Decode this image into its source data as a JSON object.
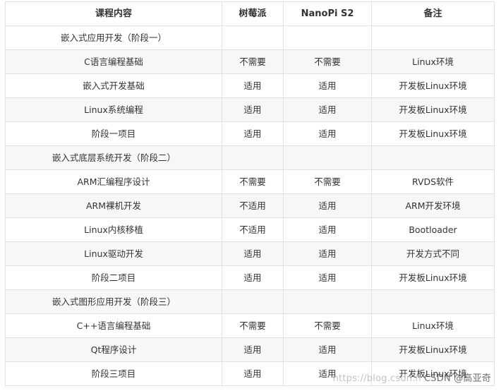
{
  "table": {
    "headers": [
      "课程内容",
      "树莓派",
      "NanoPi S2",
      "备注"
    ],
    "rows": [
      {
        "type": "section",
        "label": "嵌入式应用开发（阶段一）",
        "indent": 78
      },
      {
        "type": "data",
        "cells": [
          "C语言编程基础",
          "不需要",
          "不需要",
          "Linux环境"
        ]
      },
      {
        "type": "data",
        "cells": [
          "嵌入式开发基础",
          "适用",
          "适用",
          "开发板Linux环境"
        ]
      },
      {
        "type": "data",
        "cells": [
          "Linux系统编程",
          "适用",
          "适用",
          "开发板Linux环境"
        ]
      },
      {
        "type": "data",
        "cells": [
          "阶段一项目",
          "适用",
          "适用",
          "开发板Linux环境"
        ]
      },
      {
        "type": "section",
        "label": "嵌入式底层系统开发（阶段二）",
        "indent": 66
      },
      {
        "type": "data",
        "cells": [
          "ARM汇编程序设计",
          "不需要",
          "不需要",
          "RVDS软件"
        ]
      },
      {
        "type": "data",
        "cells": [
          "ARM裸机开发",
          "不适用",
          "适用",
          "ARM开发环境"
        ]
      },
      {
        "type": "data",
        "cells": [
          "Linux内核移植",
          "不适用",
          "适用",
          "Bootloader"
        ]
      },
      {
        "type": "data",
        "cells": [
          "Linux驱动开发",
          "适用",
          "适用",
          "开发方式不同"
        ]
      },
      {
        "type": "data",
        "cells": [
          "阶段二项目",
          "适用",
          "适用",
          "开发板Linux环境"
        ]
      },
      {
        "type": "section",
        "label": "嵌入式图形应用开发（阶段三）",
        "indent": 66
      },
      {
        "type": "data",
        "cells": [
          "C++语言编程基础",
          "不需要",
          "不需要",
          "Linux环境"
        ]
      },
      {
        "type": "data",
        "cells": [
          "Qt程序设计",
          "适用",
          "适用",
          "开发板Linux环境"
        ]
      },
      {
        "type": "data",
        "cells": [
          "阶段三项目",
          "适用",
          "适用",
          "开发板Linux环境"
        ]
      }
    ]
  },
  "watermark": {
    "url": "https://blog.csdn.n",
    "text": "CSDN @高亚奇"
  }
}
